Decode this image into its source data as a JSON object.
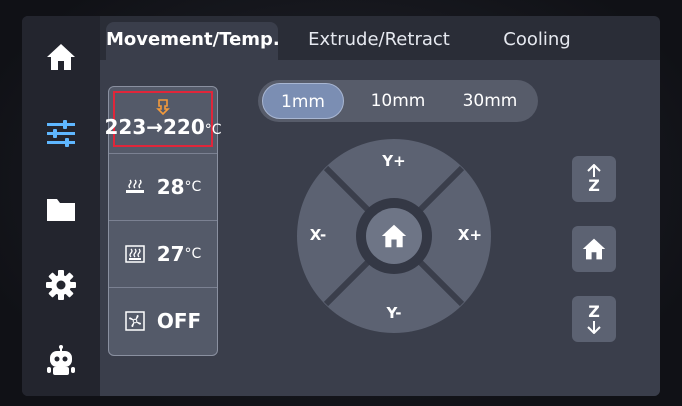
{
  "tabs": [
    {
      "label": "Movement/Temp.",
      "active": true
    },
    {
      "label": "Extrude/Retract",
      "active": false
    },
    {
      "label": "Cooling",
      "active": false
    }
  ],
  "sidebar": {
    "items": [
      {
        "icon": "home-icon"
      },
      {
        "icon": "sliders-icon",
        "active": true
      },
      {
        "icon": "folder-icon"
      },
      {
        "icon": "gear-icon"
      },
      {
        "icon": "robot-icon"
      }
    ]
  },
  "temperatures": {
    "nozzle": {
      "icon": "nozzle-icon",
      "value": "223→220",
      "unit": "°C"
    },
    "bed": {
      "icon": "heated-bed-icon",
      "value": "28",
      "unit": "°C"
    },
    "chamber": {
      "icon": "chamber-icon",
      "value": "27",
      "unit": "°C"
    },
    "fan": {
      "icon": "fan-icon",
      "value": "OFF"
    }
  },
  "steps": {
    "options": [
      "1mm",
      "10mm",
      "30mm"
    ],
    "selected": "1mm"
  },
  "jog": {
    "y_plus": "Y+",
    "y_minus": "Y-",
    "x_plus": "X+",
    "x_minus": "X-"
  },
  "z_controls": {
    "z_up": "Z",
    "z_down": "Z"
  },
  "colors": {
    "accent_highlight": "#e0263a",
    "icon_active": "#5fb7ff",
    "nozzle_icon": "#f39a3b"
  }
}
